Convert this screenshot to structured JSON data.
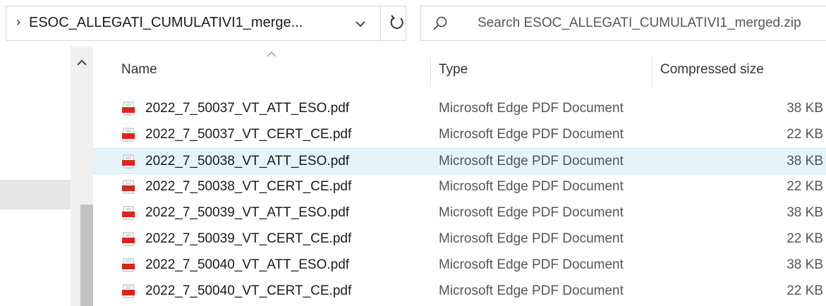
{
  "address_bar": {
    "path": "ESOC_ALLEGATI_CUMULATIVI1_merge..."
  },
  "search": {
    "placeholder": "Search ESOC_ALLEGATI_CUMULATIVI1_merged.zip"
  },
  "columns": {
    "name": "Name",
    "type": "Type",
    "size": "Compressed size"
  },
  "files": [
    {
      "name": "2022_7_50037_VT_ATT_ESO.pdf",
      "type": "Microsoft Edge PDF Document",
      "size": "38 KB",
      "selected": false
    },
    {
      "name": "2022_7_50037_VT_CERT_CE.pdf",
      "type": "Microsoft Edge PDF Document",
      "size": "22 KB",
      "selected": false
    },
    {
      "name": "2022_7_50038_VT_ATT_ESO.pdf",
      "type": "Microsoft Edge PDF Document",
      "size": "38 KB",
      "selected": true
    },
    {
      "name": "2022_7_50038_VT_CERT_CE.pdf",
      "type": "Microsoft Edge PDF Document",
      "size": "22 KB",
      "selected": false
    },
    {
      "name": "2022_7_50039_VT_ATT_ESO.pdf",
      "type": "Microsoft Edge PDF Document",
      "size": "38 KB",
      "selected": false
    },
    {
      "name": "2022_7_50039_VT_CERT_CE.pdf",
      "type": "Microsoft Edge PDF Document",
      "size": "22 KB",
      "selected": false
    },
    {
      "name": "2022_7_50040_VT_ATT_ESO.pdf",
      "type": "Microsoft Edge PDF Document",
      "size": "38 KB",
      "selected": false
    },
    {
      "name": "2022_7_50040_VT_CERT_CE.pdf",
      "type": "Microsoft Edge PDF Document",
      "size": "22 KB",
      "selected": false
    }
  ],
  "icons": {
    "address_chevron": "chevron-right-icon",
    "dropdown": "chevron-down-icon",
    "refresh": "refresh-icon",
    "search": "search-icon",
    "file": "pdf-file-icon",
    "sort": "sort-ascending-icon",
    "scroll_up": "scroll-up-icon"
  },
  "colors": {
    "selected_row": "#e5f3fb",
    "pdf_icon": "#d9261c"
  }
}
